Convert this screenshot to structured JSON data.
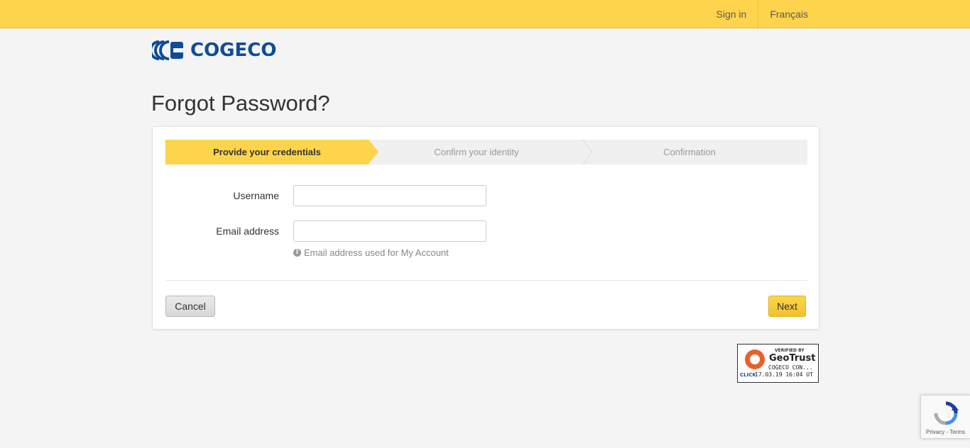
{
  "topbar": {
    "sign_in": "Sign in",
    "language": "Français",
    "color": "#fdd44b"
  },
  "logo": {
    "text": "COGECO",
    "icon": "cogeco-logo-icon",
    "color": "#0e4c97"
  },
  "page": {
    "title": "Forgot Password?"
  },
  "steps": [
    {
      "label": "Provide your credentials",
      "active": true
    },
    {
      "label": "Confirm your identity",
      "active": false
    },
    {
      "label": "Confirmation",
      "active": false
    }
  ],
  "form": {
    "username_label": "Username",
    "username_value": "",
    "email_label": "Email address",
    "email_value": "",
    "email_help": "Email address used for My Account",
    "help_icon": "info-icon"
  },
  "buttons": {
    "cancel": "Cancel",
    "next": "Next"
  },
  "geotrust": {
    "verified_by": "VERIFIED BY",
    "brand": "GeoTrust",
    "company": "COGECO CON...",
    "click": "CLICK",
    "timestamp": "17.03.19 16:04 UT",
    "icon": "geotrust-logo-icon"
  },
  "recaptcha": {
    "privacy": "Privacy",
    "separator": " - ",
    "terms": "Terms",
    "icon": "recaptcha-icon"
  }
}
